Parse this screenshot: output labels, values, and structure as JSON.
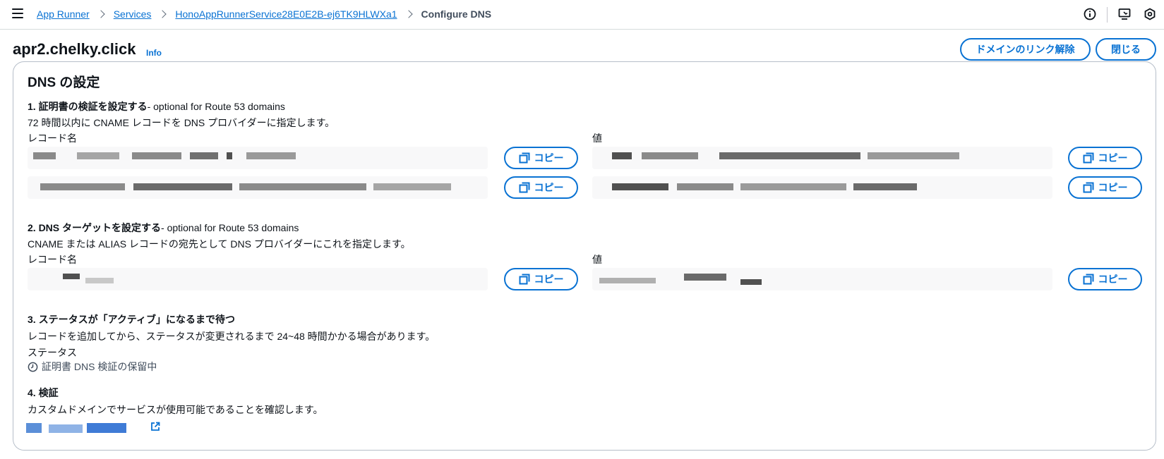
{
  "breadcrumb": {
    "items": [
      "App Runner",
      "Services",
      "HonoAppRunnerService28E0E2B-ej6TK9HLWXa1"
    ],
    "current": "Configure DNS"
  },
  "header": {
    "title": "apr2.chelky.click",
    "info": "Info",
    "unlink_label": "ドメインのリンク解除",
    "close_label": "閉じる"
  },
  "dns": {
    "title": "DNS の設定",
    "record_name_label": "レコード名",
    "value_label": "値",
    "copy_label": "コピー",
    "step1": {
      "title": "1. 証明書の検証を設定する",
      "optional": "- optional for Route 53 domains",
      "desc": "72 時間以内に CNAME レコードを DNS プロバイダーに指定します。"
    },
    "step2": {
      "title": "2. DNS ターゲットを設定する",
      "optional": "- optional for Route 53 domains",
      "desc": "CNAME または ALIAS レコードの宛先として DNS プロバイダーにこれを指定します。"
    },
    "step3": {
      "title": "3. ステータスが「アクティブ」になるまで待つ",
      "desc": "レコードを追加してから、ステータスが変更されるまで 24~48 時間かかる場合があります。",
      "status_label": "ステータス",
      "status_value": "証明書 DNS 検証の保留中"
    },
    "step4": {
      "title": "4. 検証",
      "desc": "カスタムドメインでサービスが使用可能であることを確認します。"
    }
  },
  "colors": {
    "link": "#0972d3",
    "text": "#0f141a",
    "border": "#b6bec9",
    "field_bg": "#f8f8f9"
  },
  "icons": [
    "hamburger-menu-icon",
    "info-circle-icon",
    "display-icon",
    "settings-hex-icon",
    "copy-icon",
    "clock-icon",
    "external-link-icon"
  ]
}
